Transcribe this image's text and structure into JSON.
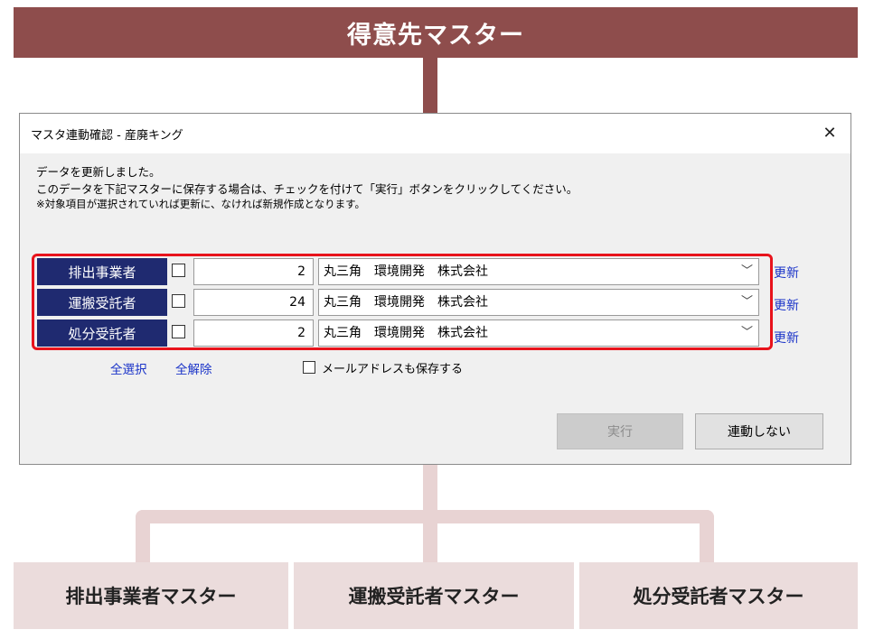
{
  "banner": {
    "title": "得意先マスター"
  },
  "dialog": {
    "title": "マスタ連動確認 - 産廃キング",
    "close_label": "✕",
    "message_1": "データを更新しました。",
    "message_2": "このデータを下記マスターに保存する場合は、チェックを付けて「実行」ボタンをクリックしてください。",
    "message_3": "※対象項目が選択されていれば更新に、なければ新規作成となります。",
    "rows": [
      {
        "label": "排出事業者",
        "checked": false,
        "number": "2",
        "company": "丸三角　環境開発　株式会社",
        "update_label": "更新"
      },
      {
        "label": "運搬受託者",
        "checked": false,
        "number": "24",
        "company": "丸三角　環境開発　株式会社",
        "update_label": "更新"
      },
      {
        "label": "処分受託者",
        "checked": false,
        "number": "2",
        "company": "丸三角　環境開発　株式会社",
        "update_label": "更新"
      }
    ],
    "select_all": "全選択",
    "deselect_all": "全解除",
    "save_email_label": "メールアドレスも保存する",
    "save_email_checked": false,
    "execute_button": "実行",
    "execute_enabled": false,
    "no_link_button": "連動しない",
    "chevron_icon": "chevron-down-icon"
  },
  "bottom": {
    "boxes": [
      "排出事業者マスター",
      "運搬受託者マスター",
      "処分受託者マスター"
    ]
  },
  "colors": {
    "banner": "#8e4d4c",
    "connector_light": "#e8d3d3",
    "bottom_box": "#ebdcdc",
    "row_label": "#1f2a70",
    "highlight": "#e8131c",
    "link": "#1a33c8"
  }
}
